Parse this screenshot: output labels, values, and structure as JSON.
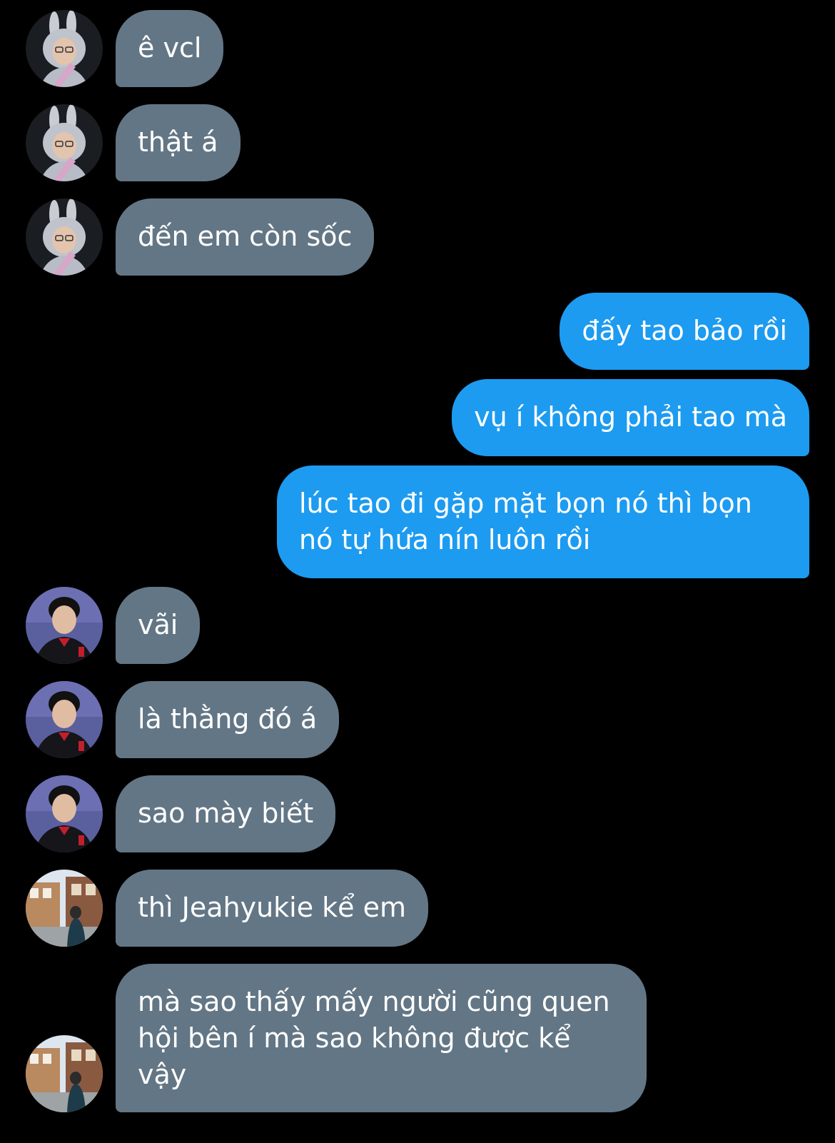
{
  "colors": {
    "background": "#000000",
    "incoming_bubble": "#637685",
    "outgoing_bubble": "#1d9bf0",
    "text": "#ffffff"
  },
  "messages": [
    {
      "direction": "in",
      "avatar": "bunny-hat-avatar",
      "text": "ê vcl"
    },
    {
      "direction": "in",
      "avatar": "bunny-hat-avatar",
      "text": "thật á"
    },
    {
      "direction": "in",
      "avatar": "bunny-hat-avatar",
      "text": "đến em còn sốc"
    },
    {
      "direction": "out",
      "text": "đấy tao bảo rồi"
    },
    {
      "direction": "out",
      "text": "vụ í không phải tao mà"
    },
    {
      "direction": "out",
      "text": "lúc tao đi gặp mặt bọn nó thì bọn nó tự hứa nín luôn rồi"
    },
    {
      "direction": "in",
      "avatar": "jersey-avatar",
      "text": "vãi"
    },
    {
      "direction": "in",
      "avatar": "jersey-avatar",
      "text": "là thằng đó á"
    },
    {
      "direction": "in",
      "avatar": "jersey-avatar",
      "text": "sao mày biết"
    },
    {
      "direction": "in",
      "avatar": "street-photo-avatar",
      "text": "thì Jeahyukie kể em"
    },
    {
      "direction": "in",
      "avatar": "street-photo-avatar",
      "text": "mà sao thấy mấy người cũng quen hội bên í mà sao không được kể vậy"
    }
  ]
}
